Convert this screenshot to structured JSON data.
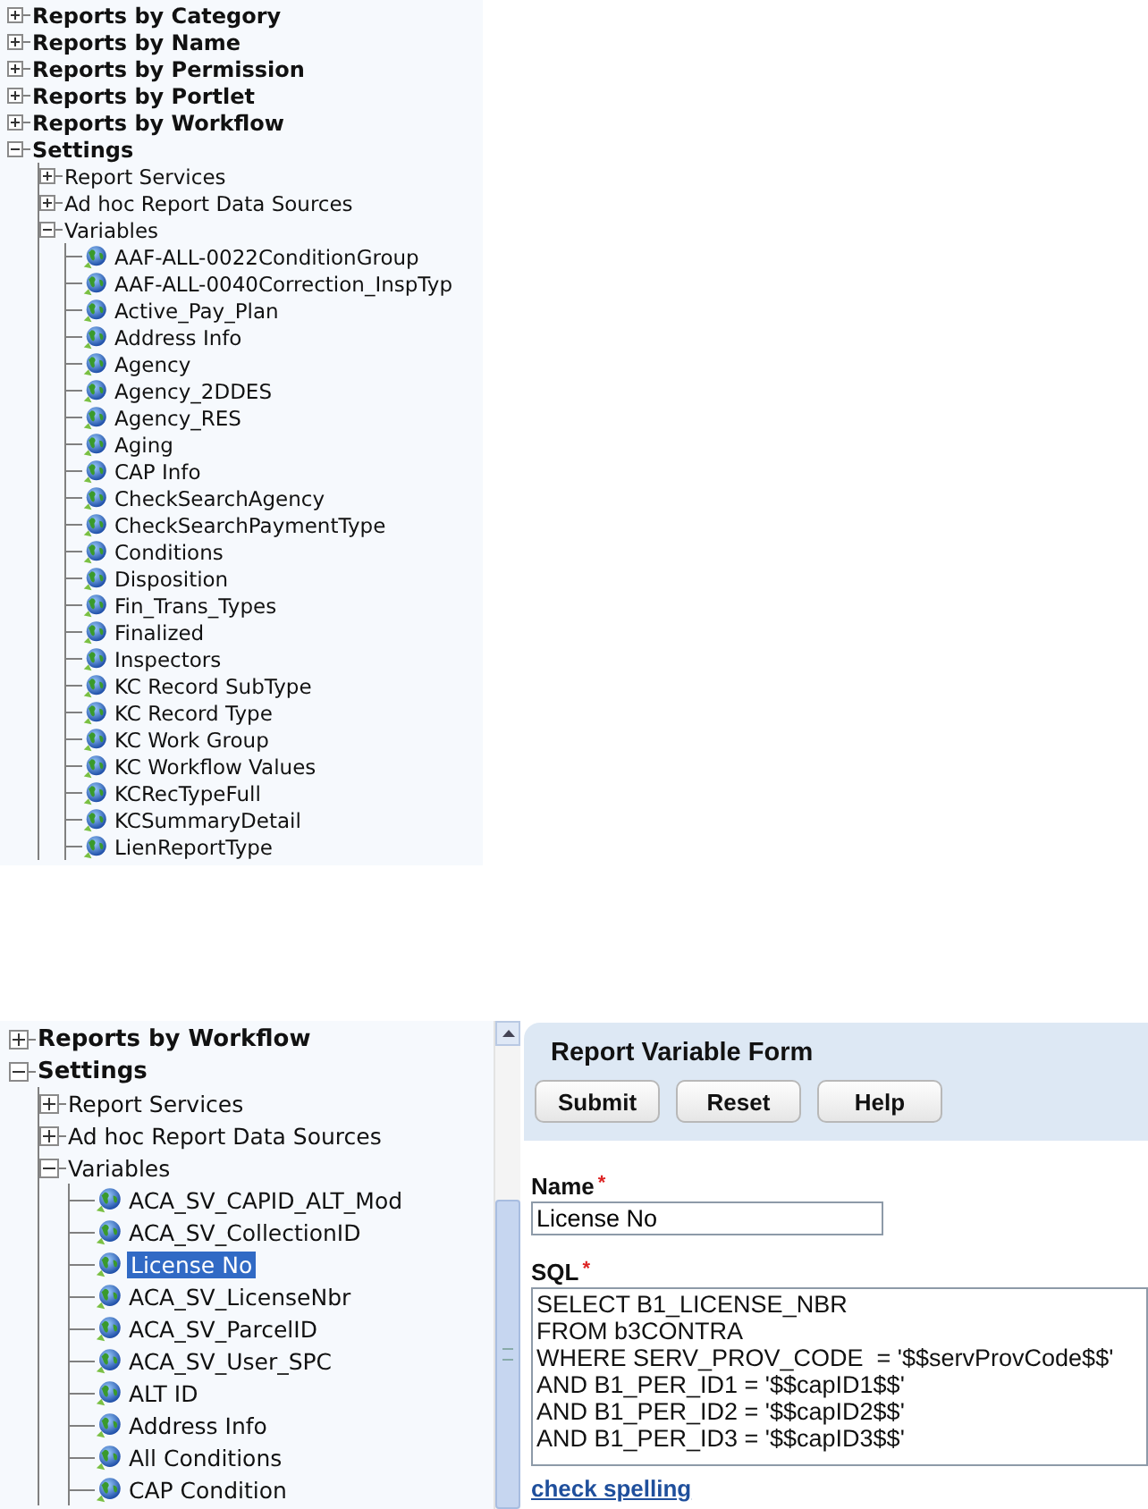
{
  "top_tree": {
    "items": [
      {
        "label": "Reports by Category",
        "kind": "folder",
        "expanded": false
      },
      {
        "label": "Reports by Name",
        "kind": "folder",
        "expanded": false
      },
      {
        "label": "Reports by Permission",
        "kind": "folder",
        "expanded": false
      },
      {
        "label": "Reports by Portlet",
        "kind": "folder",
        "expanded": false
      },
      {
        "label": "Reports by Workflow",
        "kind": "folder",
        "expanded": false
      },
      {
        "label": "Settings",
        "kind": "folder",
        "expanded": true,
        "children": [
          {
            "label": "Report Services",
            "kind": "folder",
            "expanded": false
          },
          {
            "label": "Ad hoc Report Data Sources",
            "kind": "folder",
            "expanded": false
          },
          {
            "label": "Variables",
            "kind": "folder",
            "expanded": true,
            "children": [
              {
                "label": "AAF-ALL-0022ConditionGroup",
                "kind": "variable",
                "selected": false
              },
              {
                "label": "AAF-ALL-0040Correction_InspTyp",
                "kind": "variable",
                "selected": false
              },
              {
                "label": "Active_Pay_Plan",
                "kind": "variable",
                "selected": false
              },
              {
                "label": "Address Info",
                "kind": "variable",
                "selected": false
              },
              {
                "label": "Agency",
                "kind": "variable",
                "selected": false
              },
              {
                "label": "Agency_2DDES",
                "kind": "variable",
                "selected": false
              },
              {
                "label": "Agency_RES",
                "kind": "variable",
                "selected": false
              },
              {
                "label": "Aging",
                "kind": "variable",
                "selected": false
              },
              {
                "label": "CAP Info",
                "kind": "variable",
                "selected": false
              },
              {
                "label": "CheckSearchAgency",
                "kind": "variable",
                "selected": false
              },
              {
                "label": "CheckSearchPaymentType",
                "kind": "variable",
                "selected": false
              },
              {
                "label": "Conditions",
                "kind": "variable",
                "selected": false
              },
              {
                "label": "Disposition",
                "kind": "variable",
                "selected": false
              },
              {
                "label": "Fin_Trans_Types",
                "kind": "variable",
                "selected": false
              },
              {
                "label": "Finalized",
                "kind": "variable",
                "selected": false
              },
              {
                "label": "Inspectors",
                "kind": "variable",
                "selected": false
              },
              {
                "label": "KC Record SubType",
                "kind": "variable",
                "selected": false
              },
              {
                "label": "KC Record Type",
                "kind": "variable",
                "selected": false
              },
              {
                "label": "KC Work Group",
                "kind": "variable",
                "selected": false
              },
              {
                "label": "KC Workflow Values",
                "kind": "variable",
                "selected": false
              },
              {
                "label": "KCRecTypeFull",
                "kind": "variable",
                "selected": false
              },
              {
                "label": "KCSummaryDetail",
                "kind": "variable",
                "selected": false
              },
              {
                "label": "LienReportType",
                "kind": "variable",
                "selected": false
              }
            ]
          }
        ]
      }
    ]
  },
  "bottom": {
    "tree": {
      "items": [
        {
          "label": "Reports by Workflow",
          "kind": "folder",
          "expanded": false
        },
        {
          "label": "Settings",
          "kind": "folder",
          "expanded": true,
          "children": [
            {
              "label": "Report Services",
              "kind": "folder",
              "expanded": false
            },
            {
              "label": "Ad hoc Report Data Sources",
              "kind": "folder",
              "expanded": false
            },
            {
              "label": "Variables",
              "kind": "folder",
              "expanded": true,
              "children": [
                {
                  "label": "ACA_SV_CAPID_ALT_Mod",
                  "kind": "variable",
                  "selected": false
                },
                {
                  "label": "ACA_SV_CollectionID",
                  "kind": "variable",
                  "selected": false
                },
                {
                  "label": "License No",
                  "kind": "variable",
                  "selected": true
                },
                {
                  "label": "ACA_SV_LicenseNbr",
                  "kind": "variable",
                  "selected": false
                },
                {
                  "label": "ACA_SV_ParcelID",
                  "kind": "variable",
                  "selected": false
                },
                {
                  "label": "ACA_SV_User_SPC",
                  "kind": "variable",
                  "selected": false
                },
                {
                  "label": "ALT ID",
                  "kind": "variable",
                  "selected": false
                },
                {
                  "label": "Address Info",
                  "kind": "variable",
                  "selected": false
                },
                {
                  "label": "All Conditions",
                  "kind": "variable",
                  "selected": false
                },
                {
                  "label": "CAP Condition",
                  "kind": "variable",
                  "selected": false
                }
              ]
            }
          ]
        }
      ]
    },
    "form": {
      "title": "Report Variable Form",
      "buttons": [
        "Submit",
        "Reset",
        "Help"
      ],
      "fields": [
        {
          "kind": "text",
          "label": "Name",
          "required_mark": "*",
          "value": "License No"
        },
        {
          "kind": "textarea",
          "label": "SQL",
          "required_mark": "*",
          "value": "SELECT B1_LICENSE_NBR\nFROM b3CONTRA\nWHERE SERV_PROV_CODE  = '$$servProvCode$$'\nAND B1_PER_ID1 = '$$capID1$$'\nAND B1_PER_ID2 = '$$capID2$$'\nAND B1_PER_ID3 = '$$capID3$$'"
        }
      ],
      "link": "check spelling"
    }
  }
}
